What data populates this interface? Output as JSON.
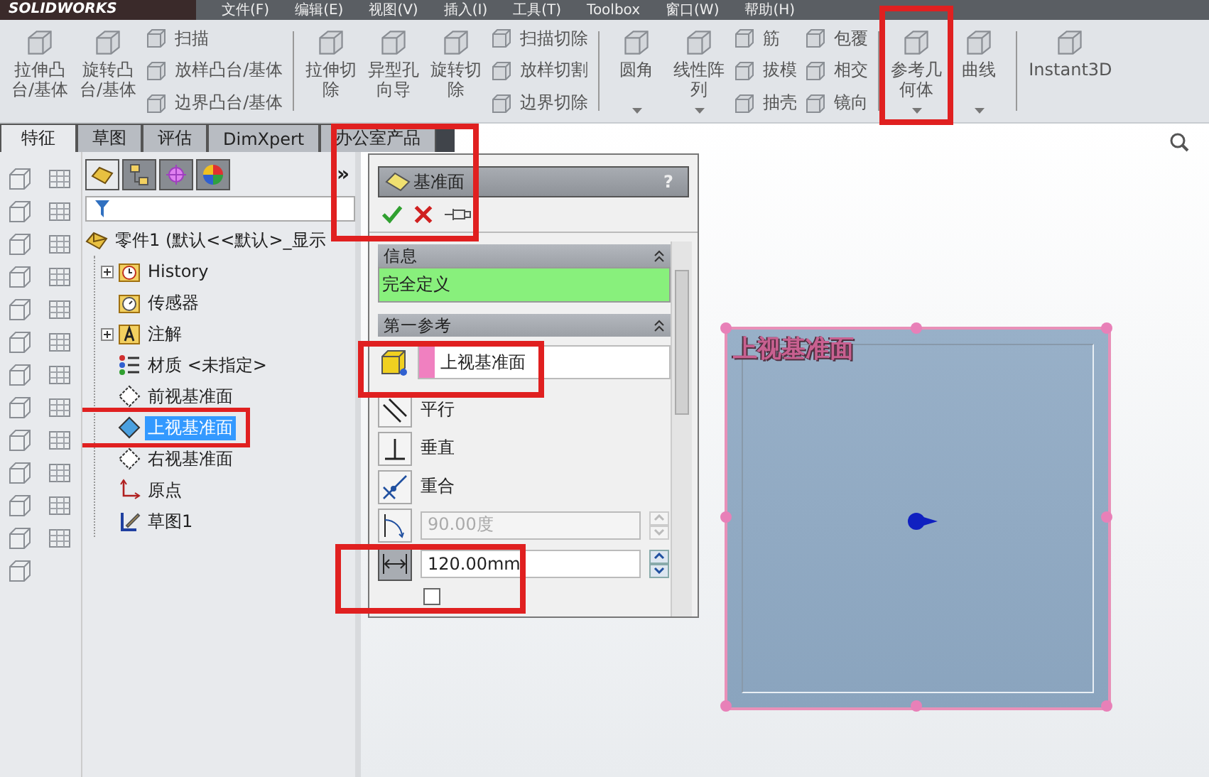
{
  "title_bar": {
    "logo": "SOLIDWORKS",
    "menu": [
      "文件(F)",
      "编辑(E)",
      "视图(V)",
      "插入(I)",
      "工具(T)",
      "Toolbox",
      "窗口(W)",
      "帮助(H)"
    ]
  },
  "toolbar": {
    "groups": [
      {
        "items": [
          {
            "kind": "large",
            "label": "拉伸凸台/基体",
            "has_menu": false
          },
          {
            "kind": "large",
            "label": "旋转凸台/基体",
            "has_menu": false
          },
          {
            "kind": "stack",
            "entries": [
              "扫描",
              "放样凸台/基体",
              "边界凸台/基体"
            ]
          }
        ]
      },
      {
        "items": [
          {
            "kind": "large",
            "label": "拉伸切除",
            "has_menu": false
          },
          {
            "kind": "large",
            "label": "异型孔向导",
            "has_menu": false
          },
          {
            "kind": "large",
            "label": "旋转切除",
            "has_menu": false
          },
          {
            "kind": "stack",
            "entries": [
              "扫描切除",
              "放样切割",
              "边界切除"
            ]
          }
        ]
      },
      {
        "items": [
          {
            "kind": "large",
            "label": "圆角",
            "has_menu": true
          },
          {
            "kind": "large",
            "label": "线性阵列",
            "has_menu": true
          },
          {
            "kind": "stack",
            "entries": [
              "筋",
              "拔模",
              "抽壳"
            ]
          },
          {
            "kind": "stack",
            "entries": [
              "包覆",
              "相交",
              "镜向"
            ]
          }
        ]
      },
      {
        "items": [
          {
            "kind": "large",
            "label": "参考几何体",
            "has_menu": true
          },
          {
            "kind": "large",
            "label": "曲线",
            "has_menu": true
          }
        ]
      },
      {
        "items": [
          {
            "kind": "large",
            "label": "Instant3D",
            "has_menu": false
          }
        ]
      }
    ]
  },
  "tabs": [
    {
      "label": "特征",
      "selected": true
    },
    {
      "label": "草图",
      "selected": false
    },
    {
      "label": "评估",
      "selected": false
    },
    {
      "label": "DimXpert",
      "selected": false
    },
    {
      "label": "办公室产品",
      "selected": false
    }
  ],
  "tree": {
    "more": "»",
    "items": [
      {
        "kind": "part",
        "label": "零件1 (默认<<默认>_显示",
        "selected": false,
        "children": [
          {
            "kind": "history",
            "label": "History",
            "selected": false,
            "expanded": false
          },
          {
            "kind": "sensor",
            "label": "传感器",
            "selected": false
          },
          {
            "kind": "annotation",
            "label": "注解",
            "selected": false,
            "expanded": false
          },
          {
            "kind": "material",
            "label": "材质 <未指定>",
            "selected": false
          },
          {
            "kind": "plane",
            "label": "前视基准面",
            "selected": false
          },
          {
            "kind": "plane",
            "label": "上视基准面",
            "selected": true
          },
          {
            "kind": "plane",
            "label": "右视基准面",
            "selected": false
          },
          {
            "kind": "origin",
            "label": "原点",
            "selected": false
          },
          {
            "kind": "sketch",
            "label": "草图1",
            "selected": false
          }
        ]
      }
    ]
  },
  "property_manager": {
    "title": "基准面",
    "help": "?",
    "sections": [
      {
        "title": "信息",
        "status": "完全定义"
      },
      {
        "title": "第一参考",
        "reference": "上视基准面"
      }
    ],
    "options": [
      {
        "kind": "parallel",
        "label": "平行",
        "selected": false
      },
      {
        "kind": "perpendicular",
        "label": "垂直",
        "selected": false
      },
      {
        "kind": "coincident",
        "label": "重合",
        "selected": false
      },
      {
        "kind": "angle",
        "value": "90.00度",
        "selected": false,
        "disabled": true
      },
      {
        "kind": "distance",
        "value": "120.00mm",
        "selected": true,
        "disabled": false
      }
    ],
    "flip_checked": false
  },
  "viewport": {
    "plane_label": "上视基准面"
  }
}
